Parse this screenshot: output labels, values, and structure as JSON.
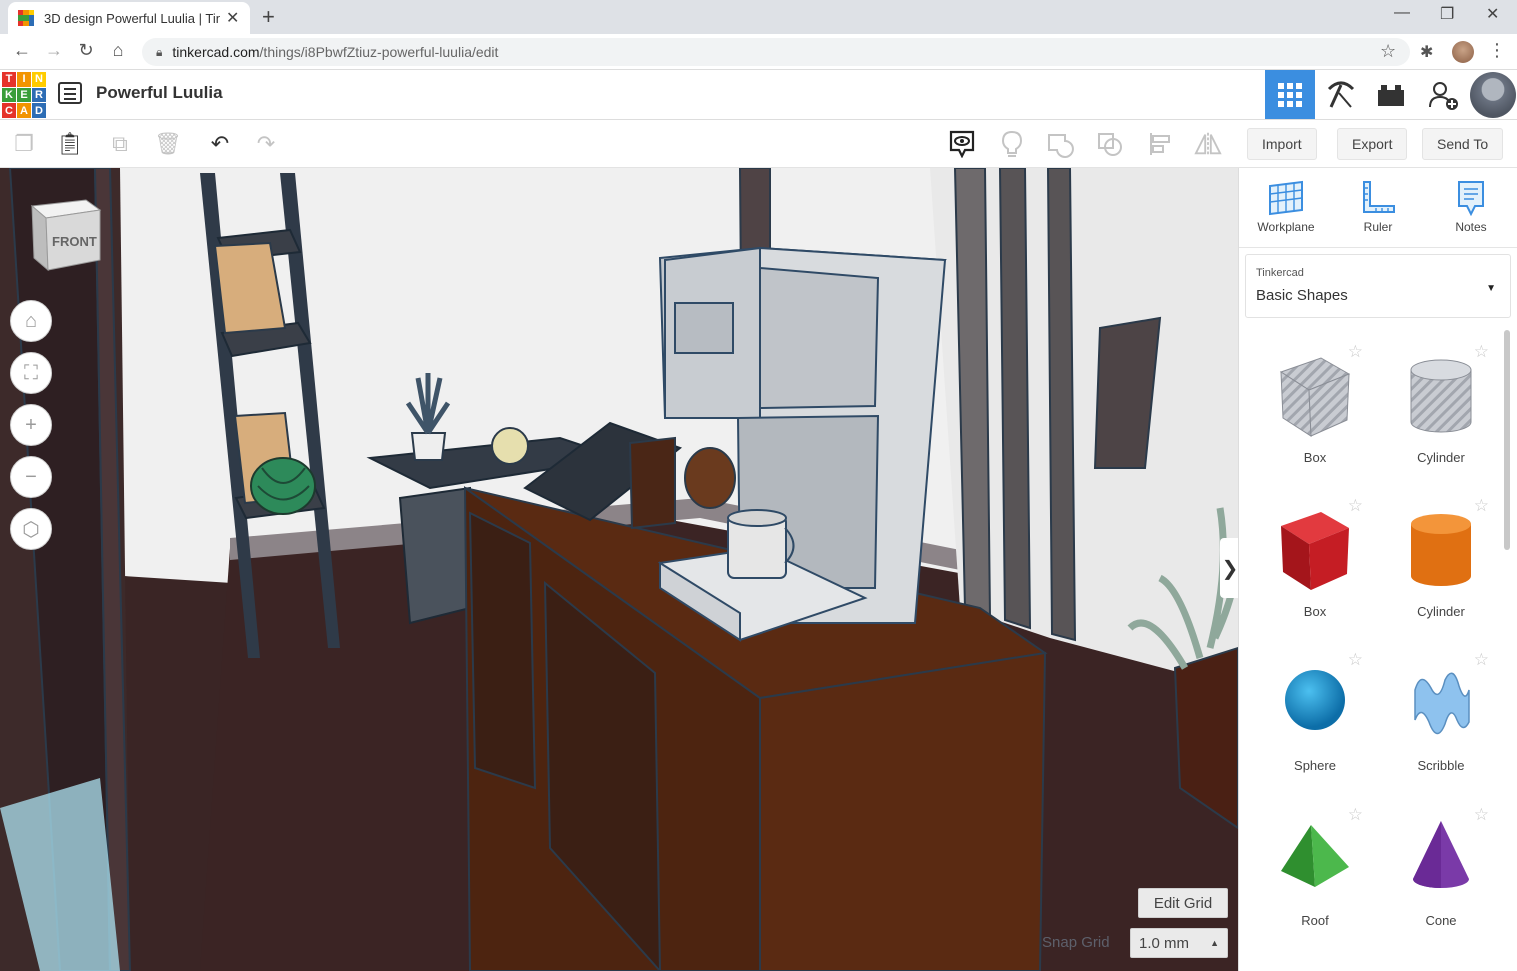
{
  "browser": {
    "tab_title": "3D design Powerful Luulia | Tinke",
    "url_host": "tinkercad.com",
    "url_path": "/things/i8PbwfZtiuz-powerful-luulia/edit"
  },
  "app": {
    "logo_letters": [
      "T",
      "I",
      "N",
      "K",
      "E",
      "R",
      "C",
      "A",
      "D"
    ],
    "logo_colors": [
      "#e5332a",
      "#f29400",
      "#ffcc00",
      "#3a9e3a",
      "#3a9e3a",
      "#2d6db5",
      "#e5332a",
      "#f29400",
      "#2d6db5"
    ],
    "design_name": "Powerful Luulia",
    "accent": "#3b8ee0"
  },
  "toolbar": {
    "import_label": "Import",
    "export_label": "Export",
    "sendto_label": "Send To"
  },
  "viewcube": {
    "face_label": "FRONT"
  },
  "grid": {
    "edit_grid_label": "Edit Grid",
    "snap_label": "Snap Grid",
    "snap_value": "1.0 mm"
  },
  "panel": {
    "tools": [
      {
        "label": "Workplane",
        "icon": "workplane-icon"
      },
      {
        "label": "Ruler",
        "icon": "ruler-icon"
      },
      {
        "label": "Notes",
        "icon": "notes-icon"
      }
    ],
    "library_source": "Tinkercad",
    "library_name": "Basic Shapes",
    "shapes": [
      {
        "label": "Box",
        "kind": "box-striped",
        "color": "#b8bcc4"
      },
      {
        "label": "Cylinder",
        "kind": "cyl-striped",
        "color": "#b8bcc4"
      },
      {
        "label": "Box",
        "kind": "box",
        "color": "#d41f26"
      },
      {
        "label": "Cylinder",
        "kind": "cyl",
        "color": "#e87511"
      },
      {
        "label": "Sphere",
        "kind": "sphere",
        "color": "#1a8bc8"
      },
      {
        "label": "Scribble",
        "kind": "scribble",
        "color": "#7fb6e6"
      },
      {
        "label": "Roof",
        "kind": "roof",
        "color": "#3aa63a"
      },
      {
        "label": "Cone",
        "kind": "cone",
        "color": "#7b3fa6"
      }
    ]
  }
}
